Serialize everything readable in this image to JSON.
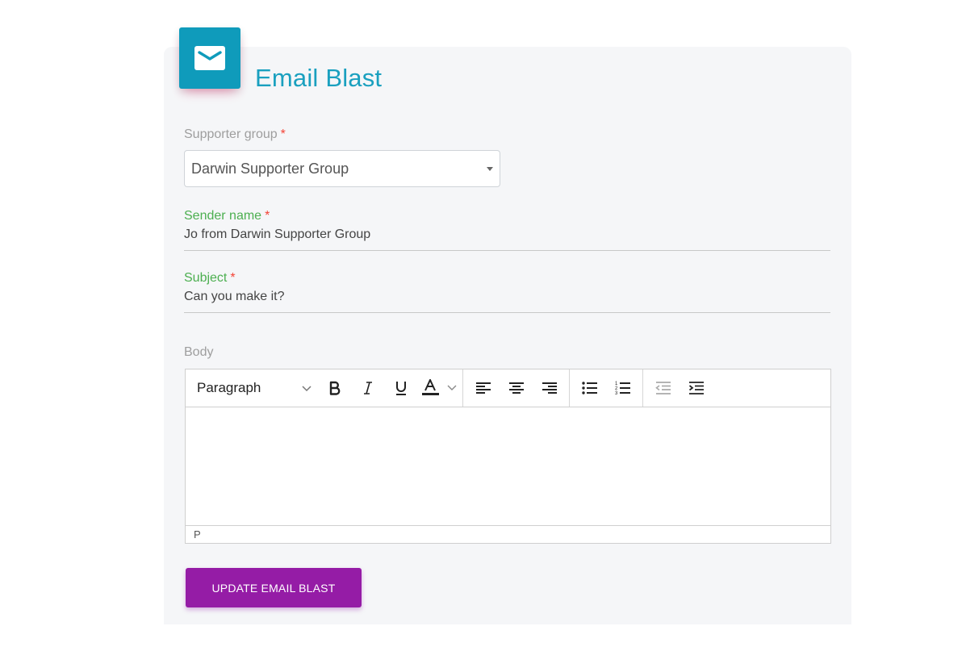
{
  "header": {
    "icon": "email-icon",
    "title": "Email Blast",
    "accent_color": "#1aa0bf"
  },
  "form": {
    "supporter_group": {
      "label": "Supporter group",
      "required_mark": "*",
      "value": "Darwin Supporter Group"
    },
    "sender_name": {
      "label": "Sender name",
      "required_mark": "*",
      "value": "Jo from Darwin Supporter Group"
    },
    "subject": {
      "label": "Subject",
      "required_mark": "*",
      "value": "Can you make it?"
    },
    "body": {
      "label": "Body",
      "toolbar": {
        "block_format": "Paragraph",
        "buttons": [
          {
            "name": "bold",
            "icon": "bold-icon"
          },
          {
            "name": "italic",
            "icon": "italic-icon"
          },
          {
            "name": "underline",
            "icon": "underline-icon"
          },
          {
            "name": "text-color",
            "icon": "text-color-icon"
          },
          {
            "name": "align-left",
            "icon": "align-left-icon"
          },
          {
            "name": "align-center",
            "icon": "align-center-icon"
          },
          {
            "name": "align-right",
            "icon": "align-right-icon"
          },
          {
            "name": "bullet-list",
            "icon": "bullet-list-icon"
          },
          {
            "name": "numbered-list",
            "icon": "numbered-list-icon"
          },
          {
            "name": "outdent",
            "icon": "outdent-icon"
          },
          {
            "name": "indent",
            "icon": "indent-icon"
          }
        ]
      },
      "content": "",
      "status_path": "P"
    },
    "submit_label": "UPDATE EMAIL BLAST",
    "submit_color": "#951ca6"
  }
}
